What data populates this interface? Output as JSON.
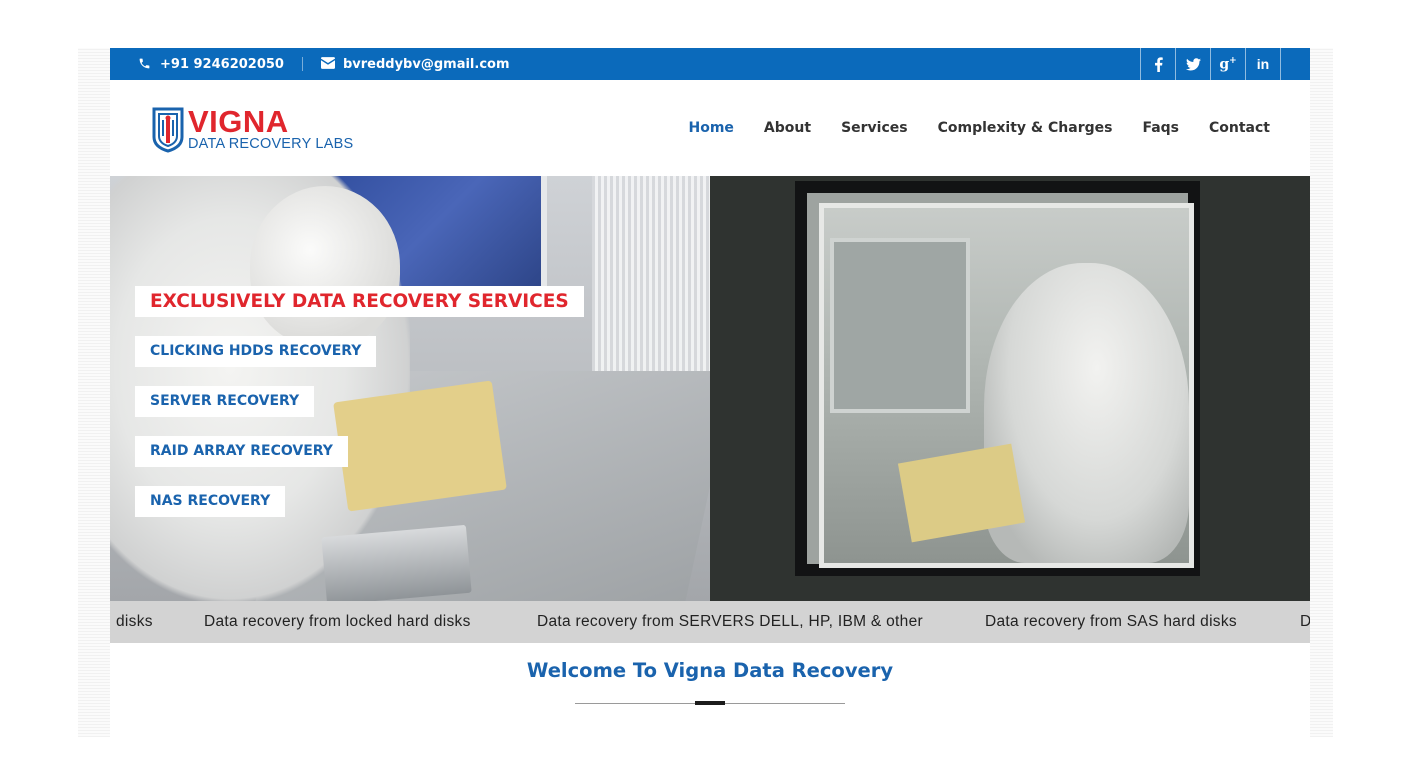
{
  "topbar": {
    "phone": "+91 9246202050",
    "email": "bvreddybv@gmail.com",
    "social": [
      {
        "name": "facebook",
        "glyph": "f"
      },
      {
        "name": "twitter",
        "glyph": "t"
      },
      {
        "name": "google-plus",
        "glyph": "g+"
      },
      {
        "name": "linkedin",
        "glyph": "in"
      }
    ],
    "bg_color": "#0b6abb"
  },
  "header": {
    "logo": {
      "name": "VIGNA",
      "tagline": "DATA RECOVERY LABS"
    },
    "nav": [
      {
        "label": "Home",
        "active": true
      },
      {
        "label": "About",
        "active": false
      },
      {
        "label": "Services",
        "active": false
      },
      {
        "label": "Complexity & Charges",
        "active": false
      },
      {
        "label": "Faqs",
        "active": false
      },
      {
        "label": "Contact",
        "active": false
      }
    ]
  },
  "hero": {
    "headline": "EXCLUSIVELY DATA RECOVERY SERVICES",
    "items": [
      "CLICKING HDDS RECOVERY",
      "SERVER RECOVERY",
      "RAID ARRAY RECOVERY",
      "NAS RECOVERY"
    ]
  },
  "marquee": {
    "items": [
      "disks",
      "Data recovery from locked hard disks",
      "Data recovery from SERVERS DELL, HP, IBM & other",
      "Data recovery from SAS hard disks",
      "D"
    ]
  },
  "welcome": {
    "title": "Welcome To Vigna Data Recovery"
  },
  "colors": {
    "accent_blue": "#1a63ad",
    "accent_red": "#e0262d",
    "marquee_bg": "#d3d3d3"
  }
}
